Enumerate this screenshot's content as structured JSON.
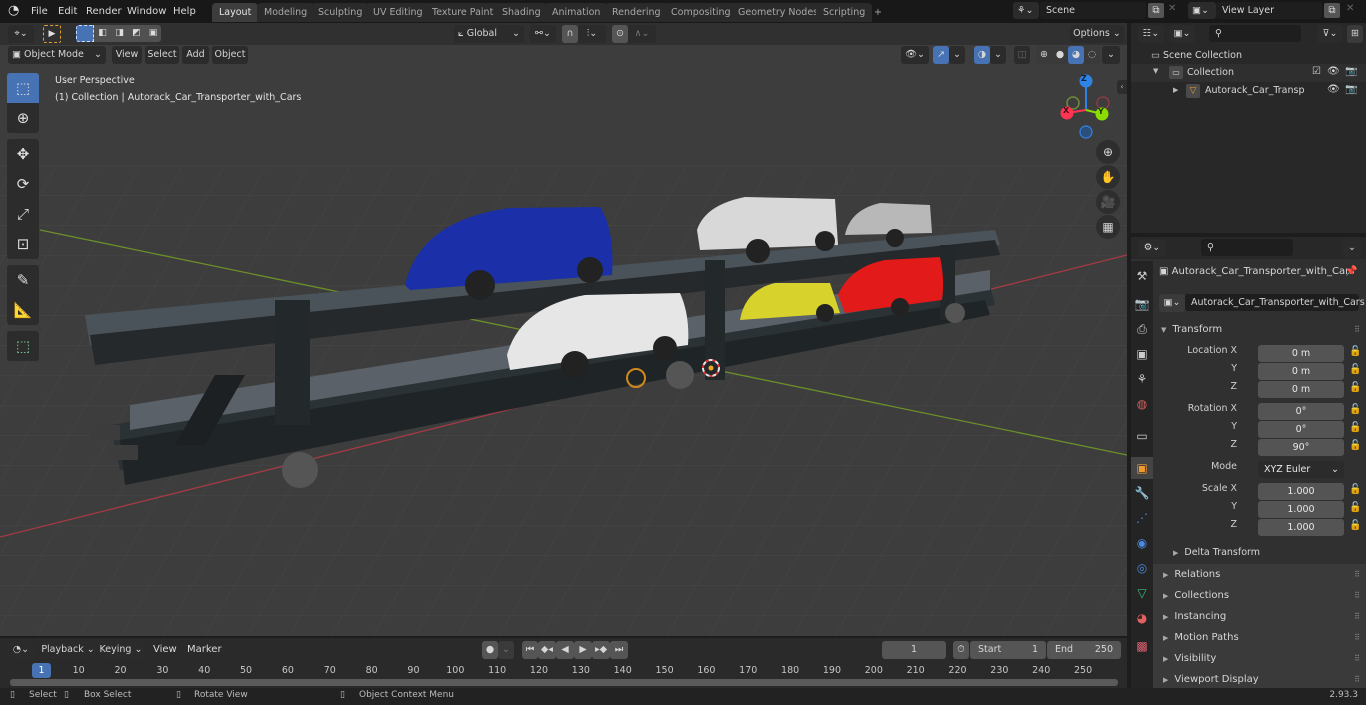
{
  "app": {
    "version": "2.93.3"
  },
  "topbar": {
    "menus": [
      "File",
      "Edit",
      "Render",
      "Window",
      "Help"
    ],
    "workspaces": [
      "Layout",
      "Modeling",
      "Sculpting",
      "UV Editing",
      "Texture Paint",
      "Shading",
      "Animation",
      "Rendering",
      "Compositing",
      "Geometry Nodes",
      "Scripting"
    ],
    "active_workspace": "Layout",
    "add_workspace": "+",
    "scene": "Scene",
    "view_layer": "View Layer"
  },
  "viewport_header": {
    "mode": "Object Mode",
    "menus": [
      "View",
      "Select",
      "Add",
      "Object"
    ],
    "orientation": "Global",
    "options": "Options"
  },
  "viewport": {
    "view_name": "User Perspective",
    "collection_info": "(1) Collection | Autorack_Car_Transporter_with_Cars",
    "gizmo_axes": {
      "x": "X",
      "y": "Y",
      "z": "Z"
    },
    "colors": {
      "x_axis": "#ff3352",
      "y_axis": "#8bdc00",
      "z_axis": "#2f83e6",
      "accent": "#4772b3",
      "selection": "#f5a623"
    },
    "scene_objects": [
      {
        "name": "blue-minivan",
        "color": "#1a2fa8"
      },
      {
        "name": "white-pickup",
        "color": "#d8d8d8"
      },
      {
        "name": "silver-mini",
        "color": "#b8b8b8"
      },
      {
        "name": "white-minivan",
        "color": "#e6e6e6"
      },
      {
        "name": "yellow-mini",
        "color": "#d8d22c"
      },
      {
        "name": "red-hatchback",
        "color": "#e21a1a"
      }
    ]
  },
  "outliner": {
    "search_placeholder": "",
    "items": [
      {
        "label": "Scene Collection",
        "level": 0
      },
      {
        "label": "Collection",
        "level": 1,
        "checked": true
      },
      {
        "label": "Autorack_Car_Transporte",
        "level": 2
      }
    ]
  },
  "properties": {
    "object_name": "Autorack_Car_Transporter_with_Cars",
    "object_field": "Autorack_Car_Transporter_with_Cars",
    "transform_label": "Transform",
    "location": {
      "label": "Location X",
      "x": "0 m",
      "y": "0 m",
      "z": "0 m"
    },
    "rotation": {
      "label": "Rotation X",
      "x": "0°",
      "y": "0°",
      "z": "90°"
    },
    "mode": {
      "label": "Mode",
      "value": "XYZ Euler"
    },
    "scale": {
      "label": "Scale X",
      "x": "1.000",
      "y": "1.000",
      "z": "1.000"
    },
    "axis_y": "Y",
    "axis_z": "Z",
    "delta_transform": "Delta Transform",
    "panels": [
      "Relations",
      "Collections",
      "Instancing",
      "Motion Paths",
      "Visibility",
      "Viewport Display"
    ]
  },
  "timeline": {
    "menus": [
      "Playback",
      "Keying",
      "View",
      "Marker"
    ],
    "current_frame": "1",
    "start_label": "Start",
    "start": "1",
    "end_label": "End",
    "end": "250",
    "playhead": "1",
    "ticks": [
      "10",
      "20",
      "30",
      "40",
      "50",
      "60",
      "70",
      "80",
      "90",
      "100",
      "110",
      "120",
      "130",
      "140",
      "150",
      "160",
      "170",
      "180",
      "190",
      "200",
      "210",
      "220",
      "230",
      "240",
      "250"
    ]
  },
  "statusbar": {
    "hints": [
      "Select",
      "Box Select",
      "Rotate View",
      "Object Context Menu"
    ],
    "version": "2.93.3"
  }
}
